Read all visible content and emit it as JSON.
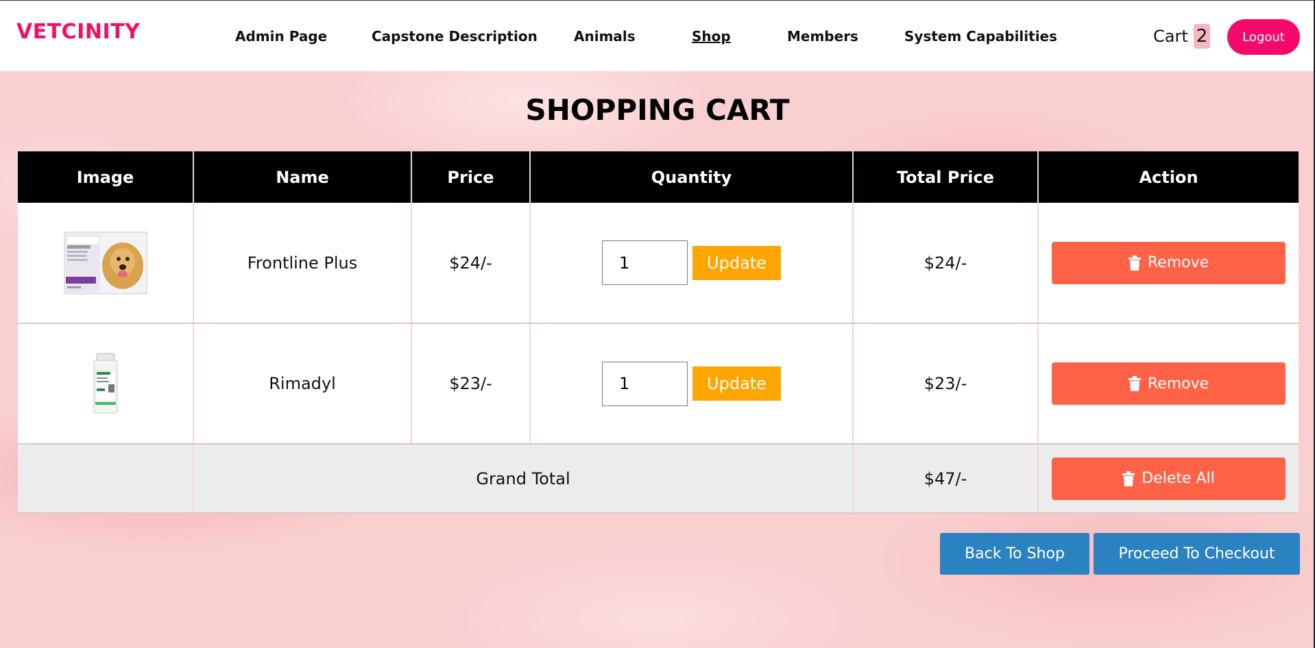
{
  "brand": "VETCINITY",
  "nav": [
    {
      "label": "Admin Page"
    },
    {
      "label": "Capstone Description"
    },
    {
      "label": "Animals"
    },
    {
      "label": "Shop"
    },
    {
      "label": "Members"
    },
    {
      "label": "System Capabilities"
    }
  ],
  "cart": {
    "label": "Cart",
    "count": "2"
  },
  "logout_label": "Logout",
  "page_title": "SHOPPING CART",
  "table": {
    "headers": [
      "Image",
      "Name",
      "Price",
      "Quantity",
      "Total Price",
      "Action"
    ],
    "rows": [
      {
        "name": "Frontline Plus",
        "price": "$24/-",
        "quantity": "1",
        "update_label": "Update",
        "total": "$24/-",
        "remove_label": "Remove",
        "image_icon": "frontline-plus-product-image"
      },
      {
        "name": "Rimadyl",
        "price": "$23/-",
        "quantity": "1",
        "update_label": "Update",
        "total": "$23/-",
        "remove_label": "Remove",
        "image_icon": "rimadyl-bottle-image"
      }
    ],
    "grand_total_label": "Grand Total",
    "grand_total": "$47/-",
    "delete_all_label": "Delete All"
  },
  "buttons": {
    "back_to_shop": "Back To Shop",
    "checkout": "Proceed To Checkout"
  },
  "colors": {
    "brand": "#ee1266",
    "logout": "#f5096a",
    "update": "#ffa500",
    "remove": "#ff6347",
    "action_blue": "#2b82c0"
  }
}
